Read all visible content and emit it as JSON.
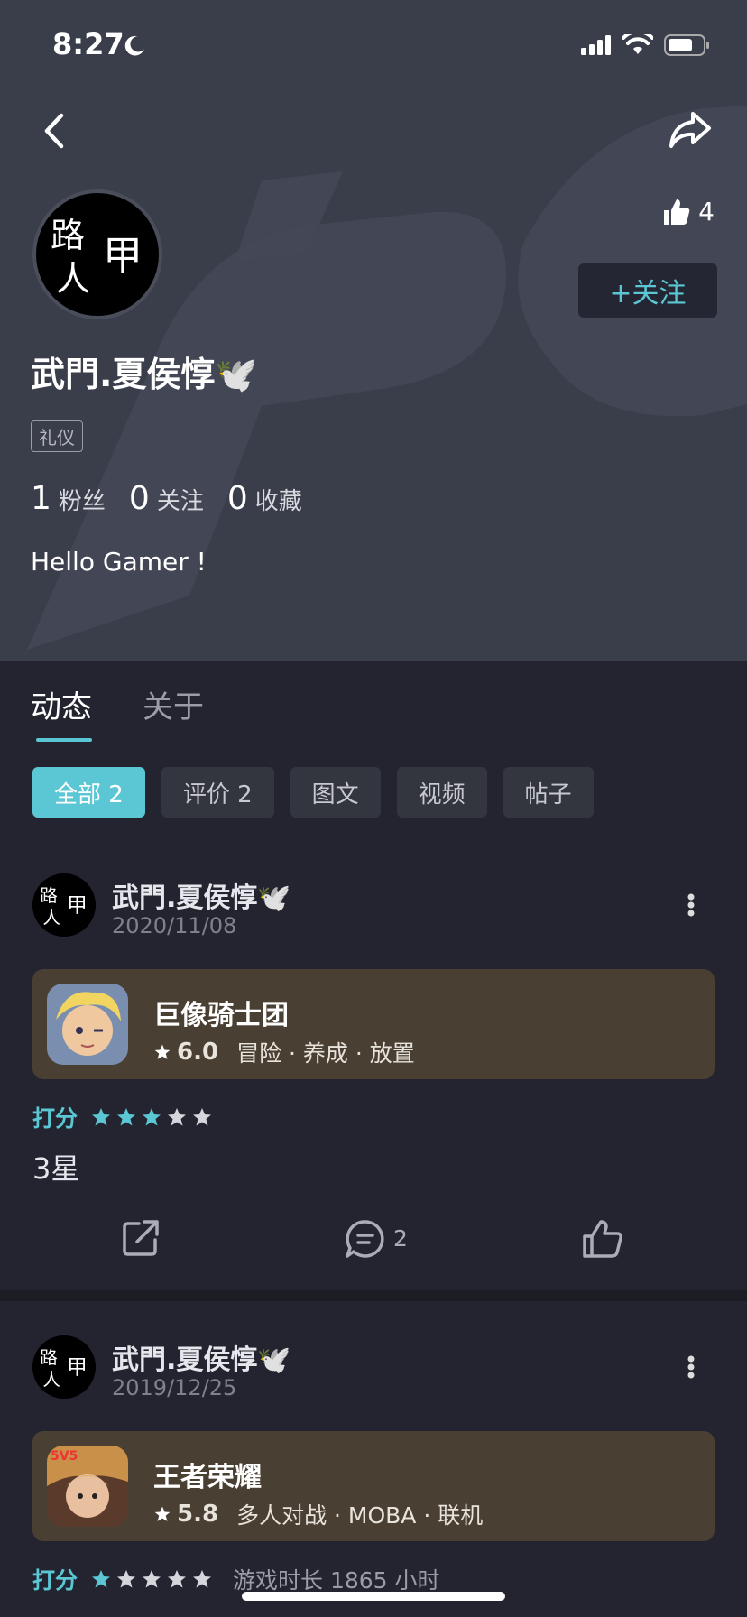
{
  "status_bar": {
    "time": "8:27"
  },
  "profile": {
    "avatar_text": [
      "路",
      "甲",
      "人"
    ],
    "likes": "4",
    "follow_label": "+关注",
    "username": "武門.夏侯惇🕊️",
    "tag": "礼仪",
    "stats": [
      {
        "value": "1",
        "label": "粉丝"
      },
      {
        "value": "0",
        "label": "关注"
      },
      {
        "value": "0",
        "label": "收藏"
      }
    ],
    "bio": "Hello Gamer !"
  },
  "tabs": [
    {
      "label": "动态",
      "active": true
    },
    {
      "label": "关于",
      "active": false
    }
  ],
  "filters": [
    {
      "label": "全部 2",
      "active": true
    },
    {
      "label": "评价 2",
      "active": false
    },
    {
      "label": "图文",
      "active": false
    },
    {
      "label": "视频",
      "active": false
    },
    {
      "label": "帖子",
      "active": false
    }
  ],
  "posts": [
    {
      "author": "武門.夏侯惇🕊️",
      "date": "2020/11/08",
      "game": {
        "title": "巨像骑士团",
        "score": "6.0",
        "genres": "冒险 · 养成 · 放置"
      },
      "rating_label": "打分",
      "stars": 3,
      "text": "3星",
      "comments": "2"
    },
    {
      "author": "武門.夏侯惇🕊️",
      "date": "2019/12/25",
      "game": {
        "title": "王者荣耀",
        "score": "5.8",
        "genres": "多人对战 · MOBA · 联机"
      },
      "rating_label": "打分",
      "stars": 1,
      "playtime": "游戏时长 1865 小时"
    }
  ],
  "colors": {
    "accent": "#5cc7d4",
    "header_bg": "#3a3d4a",
    "page_bg": "#23242f",
    "card_bg": "#4a3f33"
  }
}
